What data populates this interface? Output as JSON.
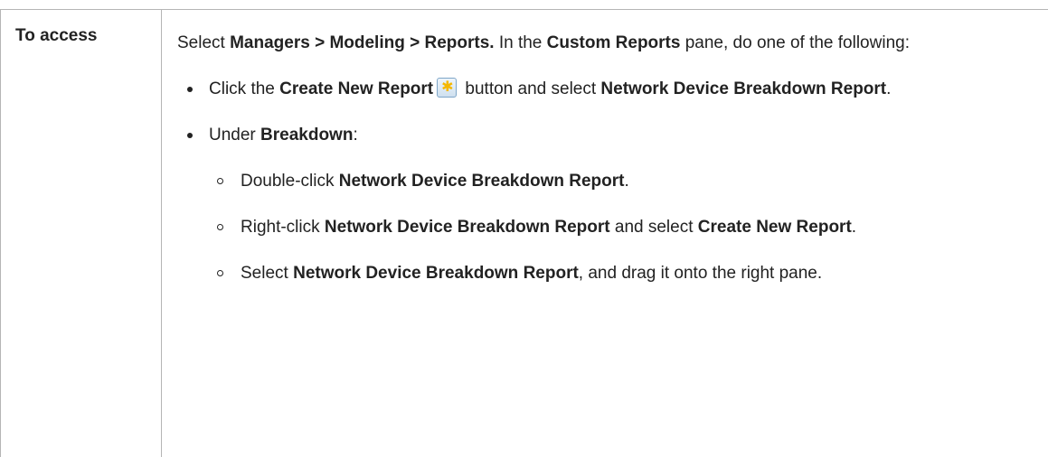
{
  "row_header": "To access",
  "intro": {
    "p1": "Select ",
    "b1": "Managers > Modeling > Reports.",
    "p2": " In the ",
    "b2": "Custom Reports",
    "p3": " pane, do one of the following:"
  },
  "bullet1": {
    "t1": "Click the ",
    "b1": "Create New Report",
    "icon": "create-new-report-icon",
    "t2": " button and select ",
    "b2": "Network Device Breakdown Report",
    "t3": "."
  },
  "bullet2": {
    "t1": "Under ",
    "b1": "Breakdown",
    "t2": ":"
  },
  "sub1": {
    "t1": "Double-click ",
    "b1": "Network Device Breakdown Report",
    "t2": "."
  },
  "sub2": {
    "t1": "Right-click ",
    "b1": "Network Device Breakdown Report",
    "t2": " and select ",
    "b2": "Create New Report",
    "t3": "."
  },
  "sub3": {
    "t1": "Select ",
    "b1": "Network Device Breakdown Report",
    "t2": ", and drag it onto the right pane."
  }
}
